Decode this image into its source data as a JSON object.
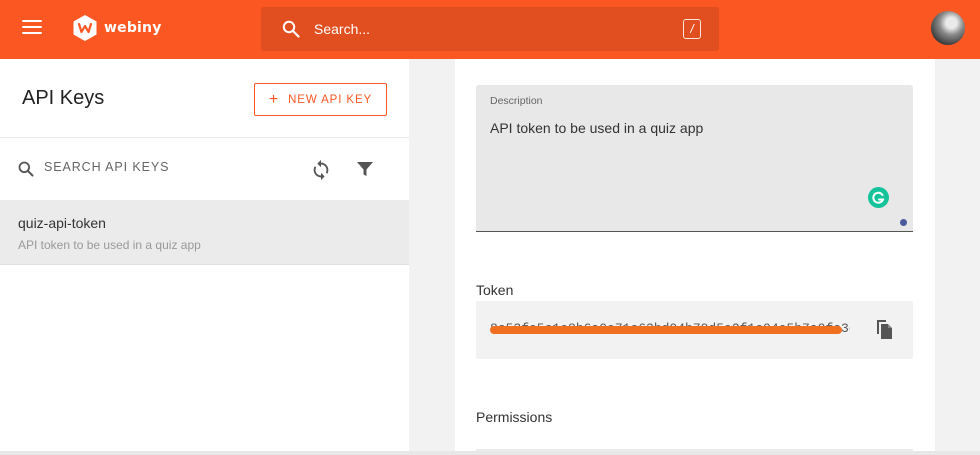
{
  "colors": {
    "brand": "#fa5723",
    "brand_dark": "#e14e1f",
    "grammarly": "#15c39a"
  },
  "header": {
    "menu_icon": "hamburger-menu-icon",
    "logo_text": "webiny",
    "search": {
      "placeholder": "Search...",
      "shortcut": "/"
    },
    "avatar_icon": "user-avatar"
  },
  "sidebar": {
    "title": "API Keys",
    "new_button_label": "NEW API KEY",
    "search_placeholder": "SEARCH API KEYS",
    "refresh_icon": "refresh-icon",
    "filter_icon": "filter-icon",
    "items": [
      {
        "name": "quiz-api-token",
        "description": "API token to be used in a quiz app"
      }
    ]
  },
  "form": {
    "description": {
      "label": "Description",
      "value": "API token to be used in a quiz app"
    },
    "token": {
      "label": "Token",
      "value": "8c53fe5c1e8b6a0e71c63bd04b79d5a2f1c04e5b7a0fe3c1"
    },
    "permissions": {
      "label": "Permissions"
    }
  }
}
